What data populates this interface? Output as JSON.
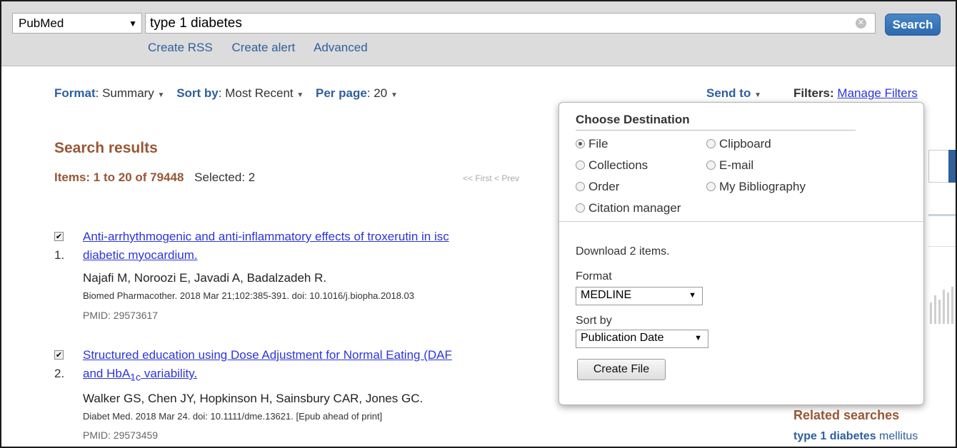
{
  "search": {
    "database": "PubMed",
    "query": "type 1 diabetes",
    "button_label": "Search",
    "links": [
      "Create RSS",
      "Create alert",
      "Advanced"
    ]
  },
  "display": {
    "format_label": "Format",
    "format_value": "Summary",
    "sort_label": "Sort by",
    "sort_value": "Most Recent",
    "perpage_label": "Per page",
    "perpage_value": "20",
    "sendto_label": "Send to",
    "filters_label": "Filters:",
    "manage_filters": "Manage Filters"
  },
  "results": {
    "title": "Search results",
    "items_text": "Items: 1 to 20 of 79448",
    "selected_text": "Selected: 2",
    "pager": "<< First   < Prev",
    "list": [
      {
        "number": "1.",
        "checked": true,
        "title_line1": "Anti-arrhythmogenic and anti-inflammatory effects of troxerutin in isc",
        "title_line2": "diabetic myocardium.",
        "authors": "Najafi M, Noroozi E, Javadi A, Badalzadeh R.",
        "journal": "Biomed Pharmacother. 2018 Mar 21;102:385-391. doi: 10.1016/j.biopha.2018.03",
        "pmid": "PMID: 29573617"
      },
      {
        "number": "2.",
        "checked": true,
        "title_line1": "Structured education using Dose Adjustment for Normal Eating (DAF",
        "title_line2_pre": "and HbA",
        "title_line2_sub": "1c",
        "title_line2_post": " variability.",
        "authors": "Walker GS, Chen JY, Hopkinson H, Sainsbury CAR, Jones GC.",
        "journal": "Diabet Med. 2018 Mar 24. doi: 10.1111/dme.13621. [Epub ahead of print]",
        "pmid": "PMID: 29573459"
      }
    ]
  },
  "sidebar": {
    "related_title": "Related searches",
    "related_bold": "type 1 diabetes",
    "related_rest": " mellitus"
  },
  "send_panel": {
    "title": "Choose Destination",
    "destinations": {
      "file": "File",
      "clipboard": "Clipboard",
      "collections": "Collections",
      "email": "E-mail",
      "order": "Order",
      "bibliography": "My Bibliography",
      "citation": "Citation manager"
    },
    "selected_destination": "File",
    "download_text": "Download 2 items.",
    "format_label": "Format",
    "format_value": "MEDLINE",
    "sort_label": "Sort by",
    "sort_value": "Publication Date",
    "create_button": "Create File"
  }
}
